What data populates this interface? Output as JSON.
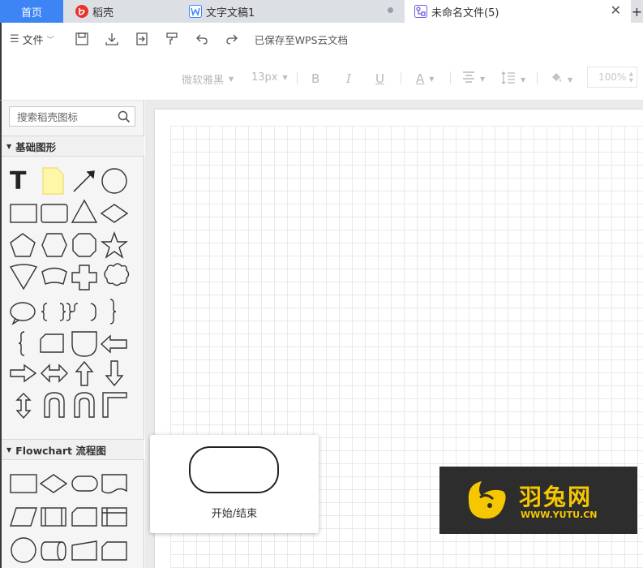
{
  "tabs": {
    "home": "首页",
    "daoke": "稻壳",
    "doc": "文字文稿1",
    "untitled": "未命名文件(5)",
    "new_tab": "+"
  },
  "toolbar": {
    "file_menu": "文件",
    "saved_status": "已保存至WPS云文档"
  },
  "format": {
    "font_family": "微软雅黑",
    "font_size": "13px",
    "bold": "B",
    "italic": "I",
    "underline": "U",
    "font_color": "A",
    "zoom": "100%"
  },
  "sidebar": {
    "search_placeholder": "搜索稻壳图标",
    "section_basic": "基础图形",
    "section_flowchart": "Flowchart 流程图"
  },
  "preview": {
    "label": "开始/结束"
  },
  "watermark": {
    "title": "羽兔网",
    "url": "WWW.YUTU.CN"
  },
  "colors": {
    "accent": "#3d84f5",
    "watermark_bg": "#2d2d2d",
    "watermark_fg": "#f6c700",
    "note_yellow": "#fff7a8"
  }
}
